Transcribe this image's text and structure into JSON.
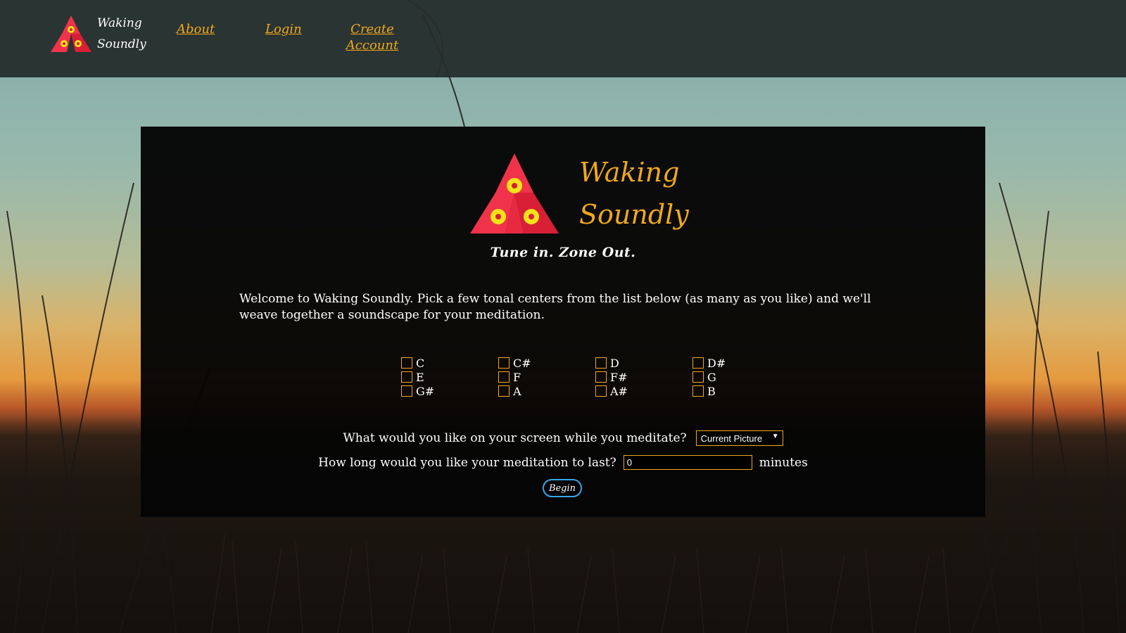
{
  "brand": {
    "name_line1": "Waking",
    "name_line2": "Soundly"
  },
  "nav": {
    "about": "About",
    "login": "Login",
    "create_line1": "Create",
    "create_line2": "Account"
  },
  "hero": {
    "title_line1": "Waking",
    "title_line2": "Soundly",
    "tagline": "Tune in. Zone Out."
  },
  "welcome_text": "Welcome to Waking Soundly. Pick a few tonal centers from the list below (as many as you like) and we'll weave together a soundscape for your meditation.",
  "notes": [
    {
      "label": "C",
      "checked": false
    },
    {
      "label": "C#",
      "checked": false
    },
    {
      "label": "D",
      "checked": false
    },
    {
      "label": "D#",
      "checked": false
    },
    {
      "label": "E",
      "checked": false
    },
    {
      "label": "F",
      "checked": false
    },
    {
      "label": "F#",
      "checked": false
    },
    {
      "label": "G",
      "checked": false
    },
    {
      "label": "G#",
      "checked": false
    },
    {
      "label": "A",
      "checked": false
    },
    {
      "label": "A#",
      "checked": false
    },
    {
      "label": "B",
      "checked": false
    }
  ],
  "screen_question": {
    "label": "What would you like on your screen while you meditate?",
    "selected": "Current Picture"
  },
  "duration_question": {
    "label": "How long would you like your meditation to last?",
    "value": "0",
    "unit": "minutes"
  },
  "begin_button": "Begin",
  "colors": {
    "accent": "#f0a81c",
    "header_bg": "#262f2e",
    "panel_bg": "#050505",
    "button_border": "#3aa6ec",
    "logo_red": "#f0334a",
    "logo_yellow": "#f5e21a"
  }
}
